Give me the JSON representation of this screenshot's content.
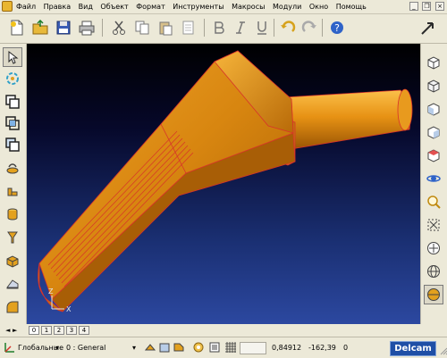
{
  "menu": {
    "items": [
      "Файл",
      "Правка",
      "Вид",
      "Объект",
      "Формат",
      "Инструменты",
      "Макросы",
      "Модули",
      "Окно",
      "Помощь"
    ]
  },
  "window_controls": {
    "minimize": "_",
    "restore": "❐",
    "close": "×"
  },
  "toolbar": {
    "icons": [
      "new-document-icon",
      "open-folder-icon",
      "save-icon",
      "print-icon",
      "cut-icon",
      "copy-icon",
      "paste-icon",
      "delete-icon",
      "bold-text-icon",
      "italic-text-icon",
      "underline-text-icon",
      "undo-icon",
      "redo-icon",
      "help-icon",
      "view-arrow-icon"
    ]
  },
  "left_toolbox": {
    "icons": [
      "select-arrow-icon",
      "transform-icon",
      "boolean-union-icon",
      "boolean-intersect-icon",
      "boolean-subtract-icon",
      "sweep-icon",
      "extrude-icon",
      "cylinder-icon",
      "cone-icon",
      "box-icon",
      "wedge-icon",
      "fillet-icon"
    ]
  },
  "right_toolbox": {
    "icons": [
      "shade-box-icon",
      "view-iso-icon",
      "view-front-icon",
      "view-right-icon",
      "view-top-icon",
      "orbit-icon",
      "zoom-realtime-icon",
      "zoom-extents-icon",
      "pan-icon",
      "wireframe-icon",
      "shaded-icon"
    ]
  },
  "viewport": {
    "axis": {
      "z": "Z",
      "x": "X"
    }
  },
  "layer_tabs": {
    "labels": [
      "0",
      "1",
      "2",
      "3",
      "4"
    ],
    "active": "0"
  },
  "statusbar": {
    "coordinate_system": "Глобальные",
    "layer_field": "0  : General",
    "coord_1": "0,84912",
    "coord_2": "-162,39",
    "coord_3": "0"
  },
  "brand": {
    "logo_text": "Delcam"
  },
  "colors": {
    "part_orange": "#e08a10",
    "part_edge": "#d8332a",
    "viewport_top": "#000000",
    "viewport_bottom": "#2c48a0",
    "logo_blue": "#1f4fa6"
  }
}
